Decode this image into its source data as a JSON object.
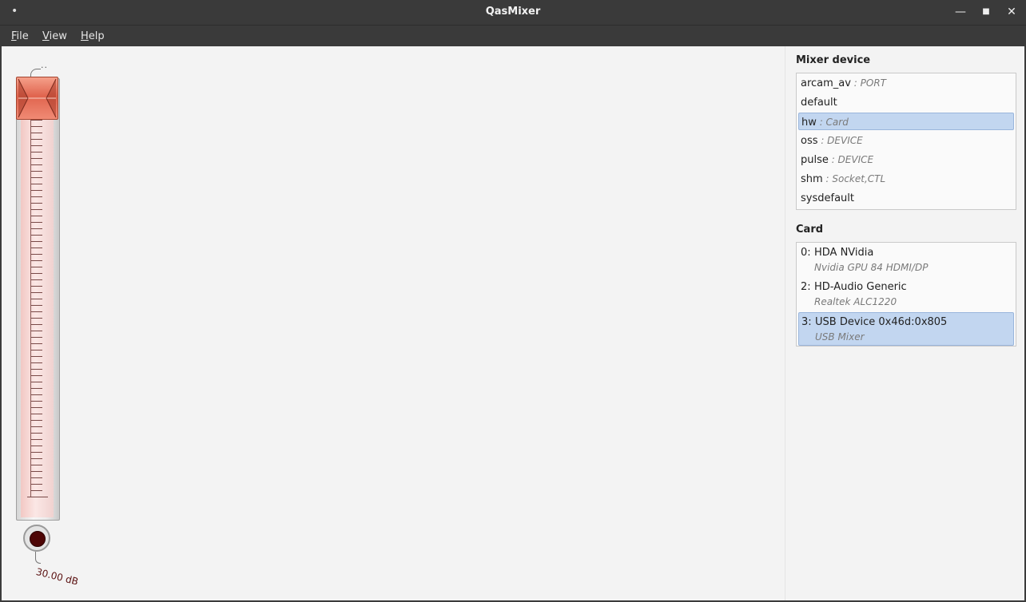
{
  "window": {
    "title": "QasMixer",
    "menu_dot": "•",
    "controls": {
      "minimize": "—",
      "maximize": "■",
      "close": "✕"
    }
  },
  "menubar": [
    {
      "mnemonic": "F",
      "rest": "ile"
    },
    {
      "mnemonic": "V",
      "rest": "iew"
    },
    {
      "mnemonic": "H",
      "rest": "elp"
    }
  ],
  "slider": {
    "top_marker": "··",
    "value_label": "30.00 dB",
    "level_fraction": 1.0,
    "handle_color": "#e0644e",
    "knob_color": "#4e0606"
  },
  "mixer_device": {
    "title": "Mixer device",
    "items": [
      {
        "name": "arcam_av",
        "type": " : PORT"
      },
      {
        "name": "default",
        "type": ""
      },
      {
        "name": "hw",
        "type": " : Card",
        "selected": true
      },
      {
        "name": "oss",
        "type": " : DEVICE"
      },
      {
        "name": "pulse",
        "type": " : DEVICE"
      },
      {
        "name": "shm",
        "type": " : Socket,CTL"
      },
      {
        "name": "sysdefault",
        "type": ""
      }
    ]
  },
  "card": {
    "title": "Card",
    "items": [
      {
        "index": "0:",
        "name": "HDA NVidia",
        "desc": "Nvidia GPU 84 HDMI/DP"
      },
      {
        "index": "2:",
        "name": "HD-Audio Generic",
        "desc": "Realtek ALC1220"
      },
      {
        "index": "3:",
        "name": "USB Device 0x46d:0x805",
        "desc": "USB Mixer",
        "selected": true
      }
    ]
  },
  "colors": {
    "selection": "#c2d6f0",
    "titlebar": "#3a3a3a"
  }
}
